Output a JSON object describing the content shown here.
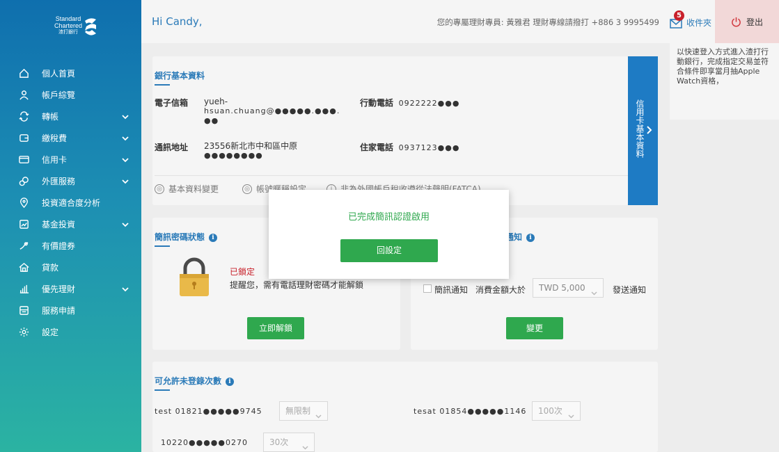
{
  "brand": {
    "line1": "Standard",
    "line2": "Chartered",
    "line3": "渣打銀行"
  },
  "sidebar": {
    "items": [
      {
        "label": "個人首頁",
        "icon": "home-icon",
        "expandable": false
      },
      {
        "label": "帳戶綜覽",
        "icon": "person-icon",
        "expandable": false
      },
      {
        "label": "轉帳",
        "icon": "transfer-icon",
        "expandable": true
      },
      {
        "label": "繳稅費",
        "icon": "wallet-icon",
        "expandable": true
      },
      {
        "label": "信用卡",
        "icon": "credit-card-icon",
        "expandable": true
      },
      {
        "label": "外匯服務",
        "icon": "exchange-icon",
        "expandable": true
      },
      {
        "label": "投資適合度分析",
        "icon": "location-pin-icon",
        "expandable": false
      },
      {
        "label": "基金投資",
        "icon": "fund-icon",
        "expandable": true
      },
      {
        "label": "有價證券",
        "icon": "securities-icon",
        "expandable": false
      },
      {
        "label": "貸款",
        "icon": "house-icon",
        "expandable": false
      },
      {
        "label": "優先理財",
        "icon": "bar-chart-icon",
        "expandable": true
      },
      {
        "label": "服務申請",
        "icon": "form-icon",
        "expandable": false
      },
      {
        "label": "設定",
        "icon": "gear-icon",
        "expandable": false
      }
    ]
  },
  "header": {
    "greeting": "Hi Candy,",
    "agent_text": "您的專屬理財專員: 黃雅君 理財專線請撥打 +886 3 9995499",
    "inbox_count": "5",
    "inbox_label": "收件夾",
    "logout_label": "登出"
  },
  "promo": {
    "text": "以快速登入方式進入渣打行動銀行，完成指定交易並符合條件即享當月抽Apple Watch資格，"
  },
  "basic_info": {
    "title": "銀行基本資料",
    "email_key": "電子信箱",
    "email_line1": "yueh-",
    "email_line2": "hsuan.chuang@●●●●●.●●●.",
    "email_line3": "●●",
    "mobile_key": "行動電話",
    "mobile_val": "0922222●●●",
    "address_key": "通訊地址",
    "address_line1": "23556新北市中和區中原",
    "address_line2": "●●●●●●●●",
    "home_key": "住家電話",
    "home_val": "0937123●●●",
    "links": [
      "基本資料變更",
      "帳號暱稱設定",
      "非為外國帳戶稅收遵從法聲明(FATCA)"
    ],
    "cc_tab_label": "信用卡基本資料"
  },
  "sms_card": {
    "title": "簡訊密碼狀態",
    "status": "已鎖定",
    "hint": "提醒您，需有電話理財密碼才能解鎖",
    "button": "立即解鎖"
  },
  "cc_notify": {
    "title": "信用卡通知",
    "checkbox_label": "簡訊通知",
    "amount_label": "消費金額大於",
    "amount_value": "TWD 5,000",
    "send_label": "發送通知",
    "button": "變更"
  },
  "unregistered": {
    "title": "可允許未登錄次數",
    "rows": [
      {
        "name": "test 01821●●●●●9745",
        "value": "無限制"
      },
      {
        "name": "tesat 01854●●●●●1146",
        "value": "100次"
      },
      {
        "name": "10220●●●●●0270",
        "value": "30次"
      }
    ]
  },
  "modal": {
    "message": "已完成簡訊認證啟用",
    "button": "回設定"
  }
}
